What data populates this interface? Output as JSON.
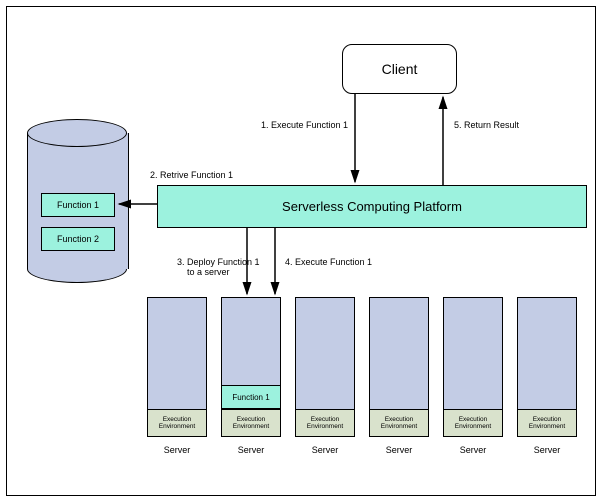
{
  "client": {
    "label": "Client"
  },
  "platform": {
    "label": "Serverless Computing Platform"
  },
  "database": {
    "function1": "Function 1",
    "function2": "Function 2"
  },
  "arrows": {
    "a1": "1. Execute Function 1",
    "a2": "2. Retrive Function 1",
    "a3": "3. Deploy Function 1\n    to a server",
    "a4": "4. Execute Function 1",
    "a5": "5. Return Result"
  },
  "servers": [
    {
      "label": "Server",
      "env": "Execution Environment",
      "function": null
    },
    {
      "label": "Server",
      "env": "Execution Environment",
      "function": "Function 1"
    },
    {
      "label": "Server",
      "env": "Execution Environment",
      "function": null
    },
    {
      "label": "Server",
      "env": "Execution Environment",
      "function": null
    },
    {
      "label": "Server",
      "env": "Execution Environment",
      "function": null
    },
    {
      "label": "Server",
      "env": "Execution Environment",
      "function": null
    }
  ]
}
